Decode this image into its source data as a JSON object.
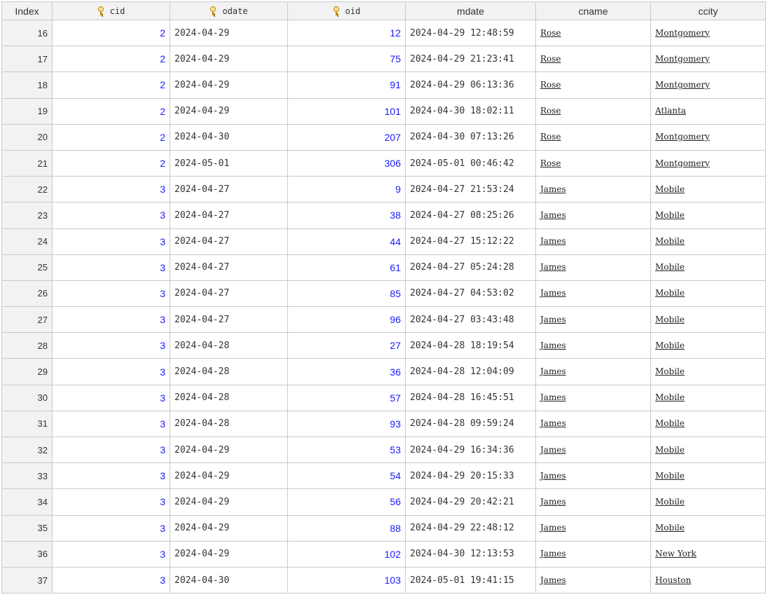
{
  "columns": [
    {
      "label": "Index",
      "key": false
    },
    {
      "label": "cid",
      "key": true
    },
    {
      "label": "odate",
      "key": true
    },
    {
      "label": "oid",
      "key": true
    },
    {
      "label": "mdate",
      "key": false
    },
    {
      "label": "cname",
      "key": false
    },
    {
      "label": "ccity",
      "key": false
    }
  ],
  "rows": [
    {
      "index": "16",
      "cid": "2",
      "odate": "2024-04-29",
      "oid": "12",
      "mdate": "2024-04-29 12:48:59",
      "cname": "Rose",
      "ccity": "Montgomery"
    },
    {
      "index": "17",
      "cid": "2",
      "odate": "2024-04-29",
      "oid": "75",
      "mdate": "2024-04-29 21:23:41",
      "cname": "Rose",
      "ccity": "Montgomery"
    },
    {
      "index": "18",
      "cid": "2",
      "odate": "2024-04-29",
      "oid": "91",
      "mdate": "2024-04-29 06:13:36",
      "cname": "Rose",
      "ccity": "Montgomery"
    },
    {
      "index": "19",
      "cid": "2",
      "odate": "2024-04-29",
      "oid": "101",
      "mdate": "2024-04-30 18:02:11",
      "cname": "Rose",
      "ccity": "Atlanta"
    },
    {
      "index": "20",
      "cid": "2",
      "odate": "2024-04-30",
      "oid": "207",
      "mdate": "2024-04-30 07:13:26",
      "cname": "Rose",
      "ccity": "Montgomery"
    },
    {
      "index": "21",
      "cid": "2",
      "odate": "2024-05-01",
      "oid": "306",
      "mdate": "2024-05-01 00:46:42",
      "cname": "Rose",
      "ccity": "Montgomery"
    },
    {
      "index": "22",
      "cid": "3",
      "odate": "2024-04-27",
      "oid": "9",
      "mdate": "2024-04-27 21:53:24",
      "cname": "James",
      "ccity": "Mobile"
    },
    {
      "index": "23",
      "cid": "3",
      "odate": "2024-04-27",
      "oid": "38",
      "mdate": "2024-04-27 08:25:26",
      "cname": "James",
      "ccity": "Mobile"
    },
    {
      "index": "24",
      "cid": "3",
      "odate": "2024-04-27",
      "oid": "44",
      "mdate": "2024-04-27 15:12:22",
      "cname": "James",
      "ccity": "Mobile"
    },
    {
      "index": "25",
      "cid": "3",
      "odate": "2024-04-27",
      "oid": "61",
      "mdate": "2024-04-27 05:24:28",
      "cname": "James",
      "ccity": "Mobile"
    },
    {
      "index": "26",
      "cid": "3",
      "odate": "2024-04-27",
      "oid": "85",
      "mdate": "2024-04-27 04:53:02",
      "cname": "James",
      "ccity": "Mobile"
    },
    {
      "index": "27",
      "cid": "3",
      "odate": "2024-04-27",
      "oid": "96",
      "mdate": "2024-04-27 03:43:48",
      "cname": "James",
      "ccity": "Mobile"
    },
    {
      "index": "28",
      "cid": "3",
      "odate": "2024-04-28",
      "oid": "27",
      "mdate": "2024-04-28 18:19:54",
      "cname": "James",
      "ccity": "Mobile"
    },
    {
      "index": "29",
      "cid": "3",
      "odate": "2024-04-28",
      "oid": "36",
      "mdate": "2024-04-28 12:04:09",
      "cname": "James",
      "ccity": "Mobile"
    },
    {
      "index": "30",
      "cid": "3",
      "odate": "2024-04-28",
      "oid": "57",
      "mdate": "2024-04-28 16:45:51",
      "cname": "James",
      "ccity": "Mobile"
    },
    {
      "index": "31",
      "cid": "3",
      "odate": "2024-04-28",
      "oid": "93",
      "mdate": "2024-04-28 09:59:24",
      "cname": "James",
      "ccity": "Mobile"
    },
    {
      "index": "32",
      "cid": "3",
      "odate": "2024-04-29",
      "oid": "53",
      "mdate": "2024-04-29 16:34:36",
      "cname": "James",
      "ccity": "Mobile"
    },
    {
      "index": "33",
      "cid": "3",
      "odate": "2024-04-29",
      "oid": "54",
      "mdate": "2024-04-29 20:15:33",
      "cname": "James",
      "ccity": "Mobile"
    },
    {
      "index": "34",
      "cid": "3",
      "odate": "2024-04-29",
      "oid": "56",
      "mdate": "2024-04-29 20:42:21",
      "cname": "James",
      "ccity": "Mobile"
    },
    {
      "index": "35",
      "cid": "3",
      "odate": "2024-04-29",
      "oid": "88",
      "mdate": "2024-04-29 22:48:12",
      "cname": "James",
      "ccity": "Mobile"
    },
    {
      "index": "36",
      "cid": "3",
      "odate": "2024-04-29",
      "oid": "102",
      "mdate": "2024-04-30 12:13:53",
      "cname": "James",
      "ccity": "New York"
    },
    {
      "index": "37",
      "cid": "3",
      "odate": "2024-04-30",
      "oid": "103",
      "mdate": "2024-05-01 19:41:15",
      "cname": "James",
      "ccity": "Houston"
    }
  ],
  "colors": {
    "number_text": "#1a1aff",
    "header_bg": "#f2f2f2",
    "grid_line": "#c9c9c9",
    "key_icon": "#b8860b"
  },
  "icons": {
    "key_column": "key-icon"
  }
}
